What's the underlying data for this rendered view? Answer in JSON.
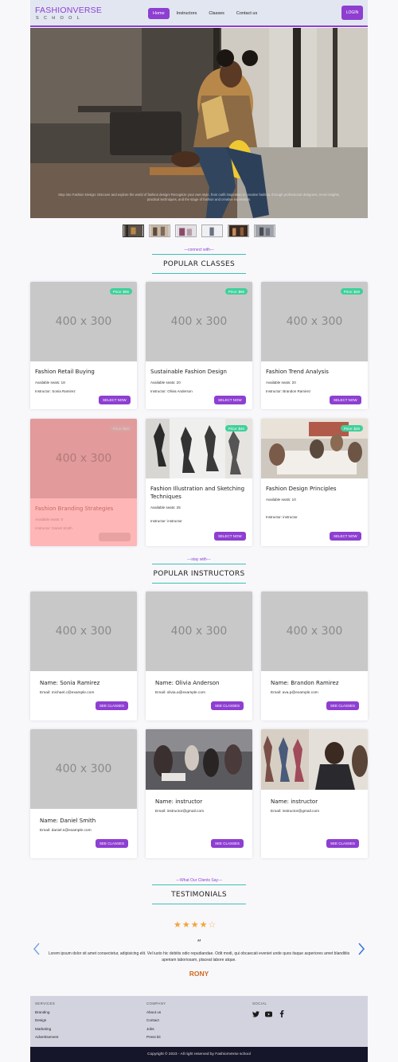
{
  "header": {
    "logo_line1": "FASHIONVERSE",
    "logo_line2": "SCHOOL",
    "nav": [
      {
        "label": "Home",
        "active": true
      },
      {
        "label": "Instructors",
        "active": false
      },
      {
        "label": "Classes",
        "active": false
      },
      {
        "label": "Contact us",
        "active": false
      }
    ],
    "login_label": "LOGIN"
  },
  "hero": {
    "caption": "Step into Fashion Design: Discover and explore the world of fashion design! Recognize your own style, from outfit inspiration to creative fashion, through professional designers, trend insights, practical techniques, and the stage of fashion and creative expression.",
    "slide_count": 6,
    "active_slide": 1,
    "thumb_count": 6
  },
  "classes_section": {
    "subtitle": "---connect with---",
    "title": "POPULAR CLASSES"
  },
  "classes": [
    {
      "name": "Fashion Retail Buying",
      "price": "Price: $55",
      "seats": "Available seats: 18",
      "instructor": "Instructor: Sonia Ramirez",
      "button": "SELECT NOW",
      "image": "placeholder",
      "disabled": false
    },
    {
      "name": "Sustainable Fashion Design",
      "price": "Price: $60",
      "seats": "Available seats: 20",
      "instructor": "Instructor: Olivia Anderson",
      "button": "SELECT NOW",
      "image": "placeholder",
      "disabled": false
    },
    {
      "name": "Fashion Trend Analysis",
      "price": "Price: $48",
      "seats": "Available seats: 20",
      "instructor": "Instructor: Brandon Ramirez",
      "button": "SELECT NOW",
      "image": "placeholder",
      "disabled": false
    },
    {
      "name": "Fashion Branding Strategies",
      "price": "Price: $50",
      "seats": "Available seats: 0",
      "instructor": "Instructor: Daniel Smith",
      "button": "SELECT NOW",
      "image": "placeholder",
      "disabled": true
    },
    {
      "name": "Fashion Illustration and Sketching Techniques",
      "price": "Price: $40",
      "seats": "Available seats: 25",
      "instructor": "Instructor: instructor",
      "button": "SELECT NOW",
      "image": "sketch-photo",
      "disabled": false
    },
    {
      "name": "Fashion Design Principles",
      "price": "Price: $25",
      "seats": "Available seats: 10",
      "instructor": "Instructor: instructor",
      "button": "SELECT NOW",
      "image": "workshop-photo",
      "disabled": false
    }
  ],
  "placeholder_text": "400 x 300",
  "instructors_section": {
    "subtitle": "---stay with---",
    "title": "POPULAR INSTRUCTORS"
  },
  "instructors": [
    {
      "name": "Name: Sonia Ramirez",
      "email": "Email: michael.c@example.com",
      "button": "SEE CLASSES",
      "image": "placeholder"
    },
    {
      "name": "Name: Olivia Anderson",
      "email": "Email: olivia.a@example.com",
      "button": "SEE CLASSES",
      "image": "placeholder"
    },
    {
      "name": "Name: Brandon Ramirez",
      "email": "Email: ava.p@example.com",
      "button": "SEE CLASSES",
      "image": "placeholder"
    },
    {
      "name": "Name: Daniel Smith",
      "email": "Email: daniel.s@example.com",
      "button": "SEE CLASSES",
      "image": "placeholder"
    },
    {
      "name": "Name: instructor",
      "email": "Email: instructor@gmail.com",
      "button": "SEE CLASSES",
      "image": "class-photo"
    },
    {
      "name": "Name: instructor",
      "email": "Email: instructor@gmail.com",
      "button": "SEE CLASSES",
      "image": "studio-photo"
    }
  ],
  "testimonials_section": {
    "subtitle": "---What Our Clients Say---",
    "title": "TESTIMONIALS"
  },
  "testimonial": {
    "rating": 4,
    "max_rating": 5,
    "quote_mark": "“",
    "text": "Lorem ipsum dolor sit amet consectetur, adipisicing elit. Vel iusto hic debitis odio repudiandae. Odit modi, qui obcaecati eveniet unde quos itaque asperiores amet blanditiis aperiam laboriosam, placeat labore atque.",
    "author": "RONY"
  },
  "footer": {
    "columns": [
      {
        "heading": "SERVICES",
        "items": [
          "Branding",
          "Design",
          "Marketing",
          "Advertisement"
        ]
      },
      {
        "heading": "COMPANY",
        "items": [
          "About us",
          "Contact",
          "Jobs",
          "Press kit"
        ]
      },
      {
        "heading": "SOCIAL",
        "items": []
      }
    ],
    "socials": [
      "twitter-icon",
      "youtube-icon",
      "facebook-icon"
    ],
    "copyright": "Copyright © 2023 - All right reserved by FashionVerse school"
  },
  "colors": {
    "accent": "#8e3fd1",
    "teal": "#3fc0b0",
    "badge": "#3fd09b",
    "author": "#d2691e",
    "footer_bg": "#d3d3df",
    "copyright_bg": "#16162a"
  }
}
